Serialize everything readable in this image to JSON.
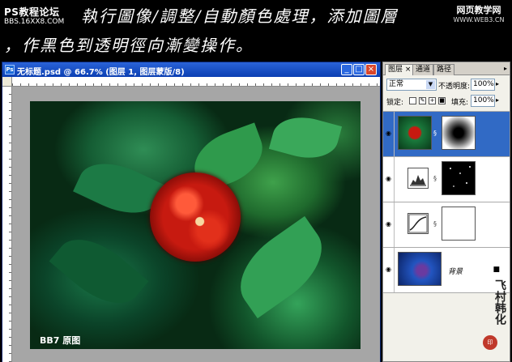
{
  "banner": {
    "logo_title": "PS教程论坛",
    "logo_url": "BBS.16XX8.COM",
    "caption_line1": "執行圖像/調整/自動顏色處理，添加圖層",
    "caption_line2": "，作黑色到透明徑向漸變操作。",
    "site_badge_1": "网页教学网",
    "site_badge_2": "WWW.WEB3.CN"
  },
  "document": {
    "icon_label": "Ps",
    "title": "无标题.psd @ 66.7% (图层 1, 图层蒙版/8)",
    "min_label": "_",
    "max_label": "□",
    "close_label": "×",
    "photo_label": "BB7 原图"
  },
  "layers_panel": {
    "tabs": [
      {
        "label": "图层 ×",
        "active": true
      },
      {
        "label": "通道",
        "active": false
      },
      {
        "label": "路径",
        "active": false
      }
    ],
    "menu_glyph": "▸",
    "blend_mode": "正常",
    "opacity_label": "不透明度:",
    "opacity_value": "100%",
    "lock_label": "锁定:",
    "fill_label": "填充:",
    "fill_value": "100%",
    "layers": [
      {
        "name": "",
        "selected": true,
        "kind": "flower-with-mask"
      },
      {
        "name": "",
        "selected": false,
        "kind": "levels-adjust"
      },
      {
        "name": "",
        "selected": false,
        "kind": "curves-adjust"
      },
      {
        "name": "背景",
        "selected": false,
        "kind": "background"
      }
    ],
    "eye_glyph": "◉",
    "chain_glyph": "§",
    "lock_glyph": "🔒"
  },
  "signature": {
    "text": "飞村韩化",
    "seal": "印"
  },
  "colors": {
    "titlebar": "#0b3fb3",
    "selection": "#316ac5",
    "flower": "#c71a10"
  }
}
